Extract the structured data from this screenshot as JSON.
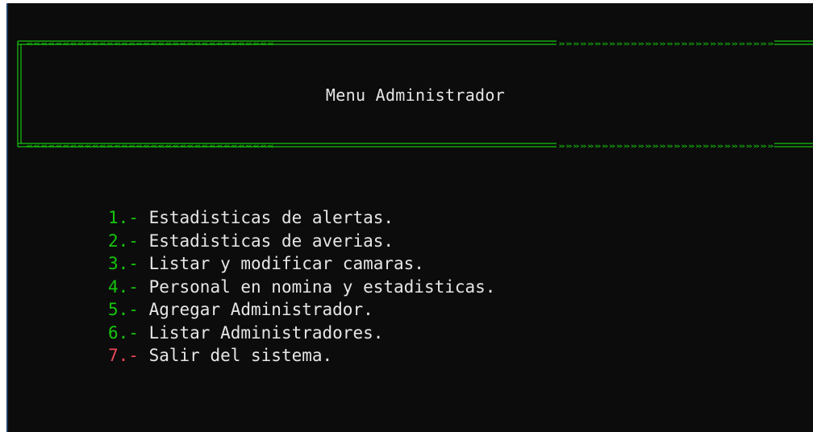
{
  "colors": {
    "background": "#0c0c0c",
    "text": "#cccccc",
    "border_green": "#16c60c",
    "number_green": "#16c60c",
    "number_red": "#e74856"
  },
  "banner": {
    "title": "Menu Administrador"
  },
  "menu": {
    "items": [
      {
        "number": "1.-",
        "label": " Estadisticas de alertas."
      },
      {
        "number": "2.-",
        "label": " Estadisticas de averias."
      },
      {
        "number": "3.-",
        "label": " Listar y modificar camaras."
      },
      {
        "number": "4.-",
        "label": " Personal en nomina y estadisticas."
      },
      {
        "number": "5.-",
        "label": " Agregar Administrador."
      },
      {
        "number": "6.-",
        "label": " Listar Administradores."
      },
      {
        "number": "7.-",
        "label": " Salir del sistema."
      }
    ]
  }
}
